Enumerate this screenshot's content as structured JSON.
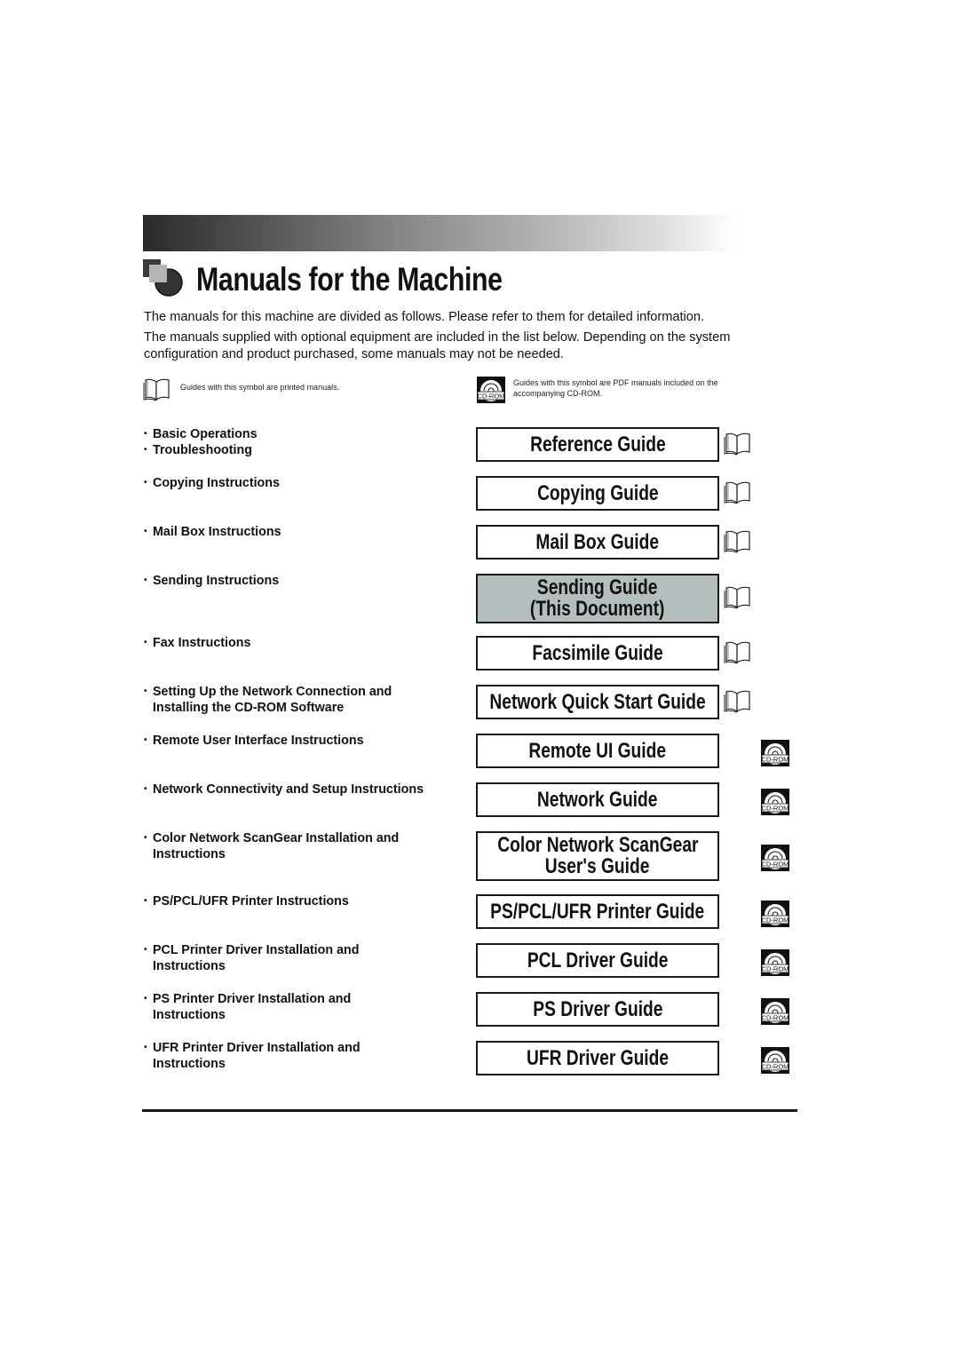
{
  "header": {
    "title": "Manuals for the Machine",
    "intro_line_1": "The manuals for this machine are divided as follows. Please refer to them for detailed information.",
    "intro_line_2": "The manuals supplied with optional equipment are included in the list below. Depending on the system",
    "intro_line_3": "configuration and product purchased, some manuals may not be needed."
  },
  "legend": {
    "printed": "Guides with this symbol are printed manuals.",
    "cdrom_line_1": "Guides with this symbol are PDF manuals included on the",
    "cdrom_line_2": "accompanying CD-ROM.",
    "cdrom_icon_label": "CD-ROM"
  },
  "manuals": [
    {
      "desc": [
        "Basic Operations",
        "Troubleshooting"
      ],
      "guide": [
        "Reference Guide"
      ],
      "type": "printed"
    },
    {
      "desc": [
        "Copying Instructions"
      ],
      "guide": [
        "Copying Guide"
      ],
      "type": "printed"
    },
    {
      "desc": [
        "Mail Box Instructions"
      ],
      "guide": [
        "Mail Box Guide"
      ],
      "type": "printed"
    },
    {
      "desc": [
        "Sending Instructions"
      ],
      "guide": [
        "Sending Guide",
        "(This Document)"
      ],
      "type": "printed",
      "current": true
    },
    {
      "desc": [
        "Fax Instructions"
      ],
      "guide": [
        "Facsimile Guide"
      ],
      "type": "printed"
    },
    {
      "desc": [
        "Setting Up the Network Connection and",
        "Installing the CD-ROM Software"
      ],
      "guide": [
        "Network Quick Start Guide"
      ],
      "type": "printed"
    },
    {
      "desc": [
        "Remote User Interface Instructions"
      ],
      "guide": [
        "Remote UI Guide"
      ],
      "type": "cdrom"
    },
    {
      "desc": [
        "Network Connectivity and Setup Instructions"
      ],
      "guide": [
        "Network Guide"
      ],
      "type": "cdrom"
    },
    {
      "desc": [
        "Color Network ScanGear Installation and",
        "Instructions"
      ],
      "guide": [
        "Color Network ScanGear",
        "User's Guide"
      ],
      "type": "cdrom"
    },
    {
      "desc": [
        "PS/PCL/UFR Printer Instructions"
      ],
      "guide": [
        "PS/PCL/UFR Printer Guide"
      ],
      "type": "cdrom"
    },
    {
      "desc": [
        "PCL Printer Driver Installation and",
        "Instructions"
      ],
      "guide": [
        "PCL Driver Guide"
      ],
      "type": "cdrom"
    },
    {
      "desc": [
        "PS Printer Driver Installation and",
        "Instructions"
      ],
      "guide": [
        "PS Driver Guide"
      ],
      "type": "cdrom"
    },
    {
      "desc": [
        "UFR Printer Driver Installation and",
        "Instructions"
      ],
      "guide": [
        "UFR Driver Guide"
      ],
      "type": "cdrom"
    }
  ],
  "colors": {
    "current_guide_fill": "#b4bebe",
    "border": "#1a1a1a"
  }
}
